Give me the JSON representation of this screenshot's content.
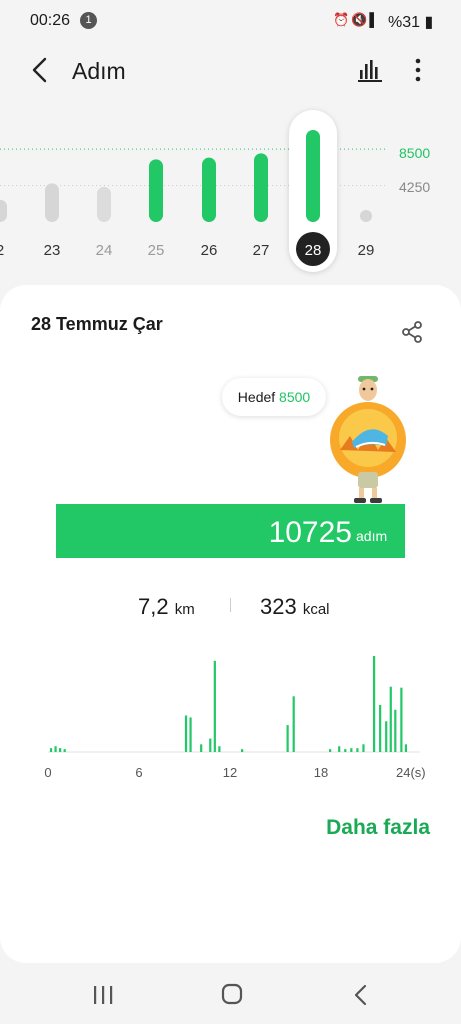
{
  "status_bar": {
    "time": "00:26",
    "notification_count": "1",
    "icons": [
      "alarm-icon",
      "mute-icon",
      "signal-icon"
    ],
    "battery": "%31"
  },
  "app_bar": {
    "title": "Adım",
    "back_icon": "back-arrow-icon",
    "chart_icon": "bar-chart-icon",
    "more_icon": "more-vertical-icon"
  },
  "weekly": {
    "goal_label": "8500",
    "mid_label": "4250",
    "selected_day": "28",
    "days": [
      {
        "label": "2",
        "steps": 2600,
        "state": "past"
      },
      {
        "label": "23",
        "steps": 4500,
        "state": "past"
      },
      {
        "label": "24",
        "steps": 4100,
        "state": "faded"
      },
      {
        "label": "25",
        "steps": 7300,
        "state": "reached"
      },
      {
        "label": "26",
        "steps": 7500,
        "state": "reached"
      },
      {
        "label": "27",
        "steps": 8000,
        "state": "reached"
      },
      {
        "label": "28",
        "steps": 10725,
        "state": "selected"
      },
      {
        "label": "29",
        "steps": 0,
        "state": "empty"
      }
    ]
  },
  "card": {
    "date": "28 Temmuz Çar",
    "share_icon": "share-icon",
    "goal_prefix": "Hedef",
    "goal_value": "8500",
    "steps": "10725",
    "steps_unit": "adım",
    "distance": "7,2",
    "distance_unit": "km",
    "calories": "323",
    "calories_unit": "kcal",
    "more_label": "Daha fazla"
  },
  "hourly": {
    "tick_labels": [
      "0",
      "6",
      "12",
      "18",
      "24(s)"
    ],
    "bars": [
      {
        "hour": 0.2,
        "value": 0.04
      },
      {
        "hour": 0.5,
        "value": 0.06
      },
      {
        "hour": 0.8,
        "value": 0.04
      },
      {
        "hour": 1.1,
        "value": 0.03
      },
      {
        "hour": 9.1,
        "value": 0.38
      },
      {
        "hour": 9.4,
        "value": 0.36
      },
      {
        "hour": 10.1,
        "value": 0.08
      },
      {
        "hour": 10.7,
        "value": 0.14
      },
      {
        "hour": 11.0,
        "value": 0.95
      },
      {
        "hour": 11.3,
        "value": 0.06
      },
      {
        "hour": 12.8,
        "value": 0.03
      },
      {
        "hour": 15.8,
        "value": 0.28
      },
      {
        "hour": 16.2,
        "value": 0.58
      },
      {
        "hour": 18.6,
        "value": 0.03
      },
      {
        "hour": 19.2,
        "value": 0.06
      },
      {
        "hour": 19.6,
        "value": 0.03
      },
      {
        "hour": 20.0,
        "value": 0.04
      },
      {
        "hour": 20.4,
        "value": 0.04
      },
      {
        "hour": 20.8,
        "value": 0.08
      },
      {
        "hour": 21.5,
        "value": 1.0
      },
      {
        "hour": 21.9,
        "value": 0.49
      },
      {
        "hour": 22.3,
        "value": 0.32
      },
      {
        "hour": 22.6,
        "value": 0.68
      },
      {
        "hour": 22.9,
        "value": 0.44
      },
      {
        "hour": 23.3,
        "value": 0.67
      },
      {
        "hour": 23.6,
        "value": 0.08
      }
    ]
  },
  "nav_bar": {
    "recents_icon": "recents-icon",
    "home_icon": "home-icon",
    "back_icon": "nav-back-icon"
  },
  "colors": {
    "accent": "#22c766",
    "accent_text": "#1aaa55",
    "past_bar": "#d6d6d6",
    "selected_pill": "#222222"
  }
}
